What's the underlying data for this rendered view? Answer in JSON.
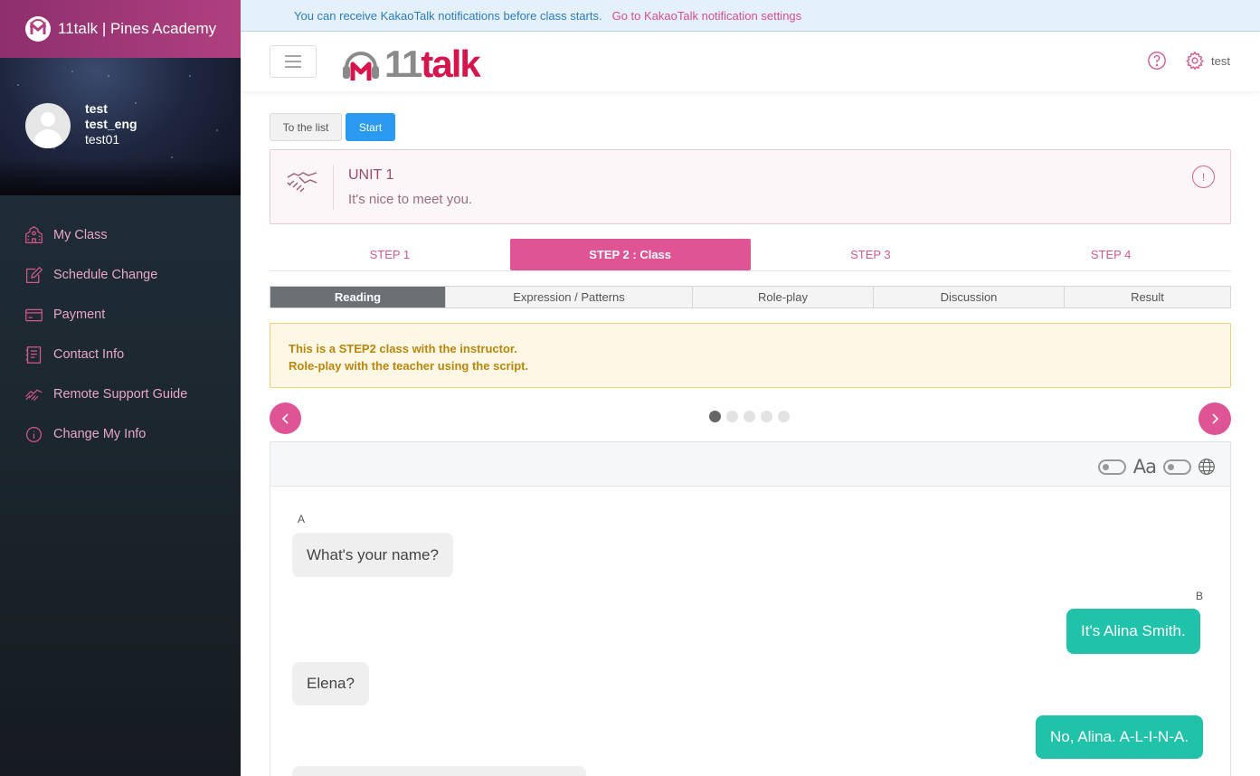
{
  "notification": {
    "message": "You can receive KakaoTalk notifications before class starts.",
    "link": "Go to KakaoTalk notification settings"
  },
  "sidebar": {
    "brand_title": "11talk | Pines Academy",
    "profile": {
      "name": "test",
      "eng_name": "test_eng",
      "user_id": "test01"
    },
    "items": [
      {
        "label": "My Class",
        "icon": "school-icon"
      },
      {
        "label": "Schedule Change",
        "icon": "edit-calendar-icon"
      },
      {
        "label": "Payment",
        "icon": "credit-card-icon"
      },
      {
        "label": "Contact Info",
        "icon": "address-book-icon"
      },
      {
        "label": "Remote Support Guide",
        "icon": "handshake-icon"
      },
      {
        "label": "Change My Info",
        "icon": "info-icon"
      }
    ]
  },
  "header": {
    "logo_number": "11",
    "logo_word": "talk",
    "user_label": "test",
    "icons": [
      "menu-icon",
      "help-icon",
      "gear-icon"
    ]
  },
  "actions": {
    "to_list": "To the list",
    "start": "Start"
  },
  "unit": {
    "title": "UNIT 1",
    "subtitle": "It's nice to meet you.",
    "icon": "handshake-icon",
    "info_icon": "!"
  },
  "steps": [
    {
      "label": "STEP 1",
      "active": false
    },
    {
      "label": "STEP 2 : Class",
      "active": true
    },
    {
      "label": "STEP 3",
      "active": false
    },
    {
      "label": "STEP 4",
      "active": false
    }
  ],
  "subtabs": [
    {
      "label": "Reading",
      "active": true
    },
    {
      "label": "Expression / Patterns",
      "active": false
    },
    {
      "label": "Role-play",
      "active": false
    },
    {
      "label": "Discussion",
      "active": false
    },
    {
      "label": "Result",
      "active": false
    }
  ],
  "notice_box": {
    "line1": "This is a STEP2 class with the instructor.",
    "line2": "Role-play with the teacher using the script."
  },
  "pager": {
    "total": 5,
    "current": 1
  },
  "toolbar": {
    "font_label": "Aa"
  },
  "dialogue": {
    "speaker_a": "A",
    "speaker_b": "B",
    "lines": [
      {
        "speaker": "A",
        "text": "What's your name?"
      },
      {
        "speaker": "B",
        "text": "It's Alina Smith."
      },
      {
        "speaker": "A",
        "text": "Elena?"
      },
      {
        "speaker": "B",
        "text": "No, Alina. A-L-I-N-A."
      }
    ]
  },
  "colors": {
    "accent": "#de5495",
    "brand_red": "#d6154f",
    "teal": "#21c2aa",
    "blue": "#2a9af0"
  }
}
